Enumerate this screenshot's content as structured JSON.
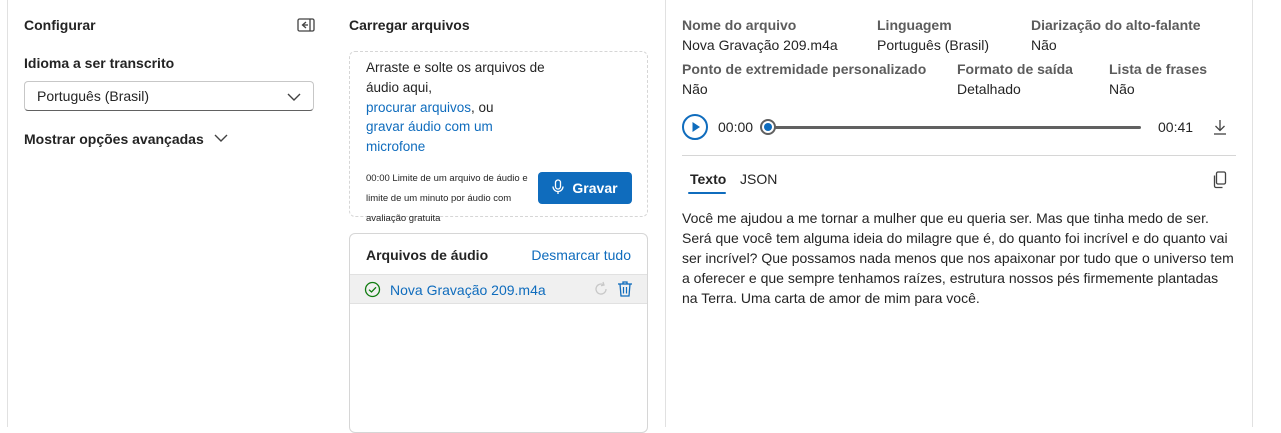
{
  "configure": {
    "title": "Configurar",
    "language_label": "Idioma a ser transcrito",
    "language_value": "Português (Brasil)",
    "advanced_toggle": "Mostrar opções avançadas"
  },
  "upload": {
    "title": "Carregar arquivos",
    "drop_text": "Arraste e solte os arquivos de áudio aqui,",
    "browse_link": "procurar arquivos",
    "or_text": ", ou",
    "record_link": "gravar áudio com um microfone",
    "limit_text": "00:00 Limite de um arquivo de áudio e limite de um minuto por áudio com avaliação gratuita",
    "record_button": "Gravar"
  },
  "audio_files": {
    "title": "Arquivos de áudio",
    "unselect_all": "Desmarcar tudo",
    "items": [
      {
        "name": "Nova Gravação 209.m4a"
      }
    ]
  },
  "details": {
    "file_name_label": "Nome do arquivo",
    "file_name_value": "Nova Gravação 209.m4a",
    "language_label": "Linguagem",
    "language_value": "Português (Brasil)",
    "diarization_label": "Diarização do alto-falante",
    "diarization_value": "Não",
    "endpoint_label": "Ponto de extremidade personalizado",
    "endpoint_value": "Não",
    "format_label": "Formato de saída",
    "format_value": "Detalhado",
    "phrase_label": "Lista de frases",
    "phrase_value": "Não"
  },
  "player": {
    "current_time": "00:00",
    "duration": "00:41",
    "progress": 0
  },
  "result_tabs": {
    "text": "Texto",
    "json": "JSON"
  },
  "transcript": "Você me ajudou a me tornar a mulher que eu queria ser. Mas que tinha medo de ser. Será que você tem alguma ideia do milagre que é, do quanto foi incrível e do quanto vai ser incrível? Que possamos nada menos que nos apaixonar por tudo que o universo tem a oferecer e que sempre tenhamos raízes, estrutura nossos pés firmemente plantadas na Terra. Uma carta de amor de mim para você.",
  "colors": {
    "accent": "#0f6cbd",
    "success": "#107c10"
  },
  "icons": [
    "collapse-panel-icon",
    "chevron-down-icon",
    "microphone-icon",
    "check-circle-icon",
    "retry-icon",
    "delete-icon",
    "play-icon",
    "download-icon",
    "copy-icon"
  ]
}
